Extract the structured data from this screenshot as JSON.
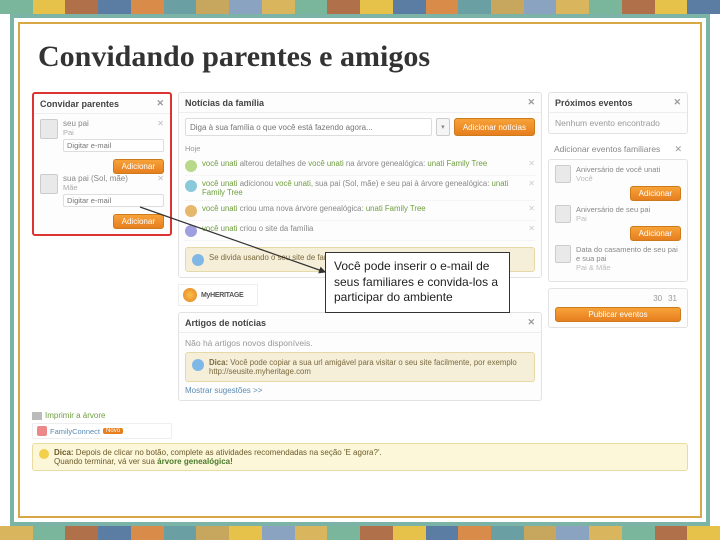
{
  "title": "Convidando parentes e amigos",
  "callout_text": "Você pode inserir o e-mail de seus familiares e convida-los a participar do ambiente",
  "stripe_colors_top": [
    "#7ab69b",
    "#e6c24a",
    "#b0704a",
    "#5b7ca3",
    "#d98c4a",
    "#6aa0a3",
    "#c7a65e",
    "#8aa3c0",
    "#d9b65e",
    "#7ab69b",
    "#b0704a",
    "#e6c24a",
    "#5b7ca3",
    "#d98c4a",
    "#6aa0a3",
    "#c7a65e",
    "#8aa3c0",
    "#d9b65e",
    "#7ab69b",
    "#b0704a",
    "#e6c24a",
    "#5b7ca3"
  ],
  "stripe_colors_bottom": [
    "#d9b65e",
    "#7ab69b",
    "#b0704a",
    "#5b7ca3",
    "#d98c4a",
    "#6aa0a3",
    "#c7a65e",
    "#e6c24a",
    "#8aa3c0",
    "#d9b65e",
    "#7ab69b",
    "#b0704a",
    "#e6c24a",
    "#5b7ca3",
    "#d98c4a",
    "#6aa0a3",
    "#c7a65e",
    "#8aa3c0",
    "#d9b65e",
    "#7ab69b",
    "#b0704a",
    "#e6c24a"
  ],
  "invite": {
    "heading": "Convidar parentes",
    "people": [
      {
        "name": "seu pai",
        "role": "Pai",
        "placeholder": "Digitar e-mail"
      },
      {
        "name": "sua pai (Sol, mãe)",
        "role": "Mãe",
        "placeholder": "Digitar e-mail"
      }
    ],
    "add_btn": "Adicionar"
  },
  "news": {
    "heading": "Notícias da família",
    "input_placeholder": "Diga à sua família o que você está fazendo agora...",
    "submit": "Adicionar notícias",
    "today_label": "Hoje",
    "feed": [
      "você unati alterou detalhes de você unati na árvore genealógica: unati Family Tree",
      "você unati adicionou você unati, sua pai (Sol, mãe) e seu pai à árvore genealógica: unati Family Tree",
      "você unati criou uma nova árvore genealógica: unati Family Tree",
      "você unati criou o site da família"
    ],
    "reminder": "Se divida usando o seu site de família no MyHeritage.com!"
  },
  "logo_text": "MyHERITAGE",
  "articles": {
    "heading": "Artigos de notícias",
    "empty": "Não há artigos novos disponíveis.",
    "suggest": "Mostrar sugestões >>",
    "tip_bold": "Dica:",
    "tip_rest": "Você pode copiar a sua url amigável para visitar o seu site facilmente, por exemplo http://seusite.myheritage.com"
  },
  "events": {
    "heading": "Próximos eventos",
    "none": "Nenhum evento encontrado",
    "add_heading": "Adicionar eventos familiares",
    "items": [
      {
        "title": "Aniversário de você unati",
        "sub": "Você"
      },
      {
        "title": "Aniversário de seu pai",
        "sub": "Pai"
      },
      {
        "title": "Data do casamento de seu pai e sua pai",
        "sub": "Pai & Mãe"
      }
    ],
    "add_btn": "Adicionar",
    "cal": [
      "30",
      "31"
    ],
    "publish": "Publicar eventos"
  },
  "bottom": {
    "print": "Imprimir a árvore",
    "fc": "FamilyConnect",
    "new_tag": "Novo"
  },
  "dica": {
    "label": "Dica:",
    "line1": "Depois de clicar no botão, complete as atividades recomendadas na seção 'E agora?'.",
    "line2_a": "Quando terminar, vá ver sua ",
    "line2_b": "árvore genealógica!"
  }
}
